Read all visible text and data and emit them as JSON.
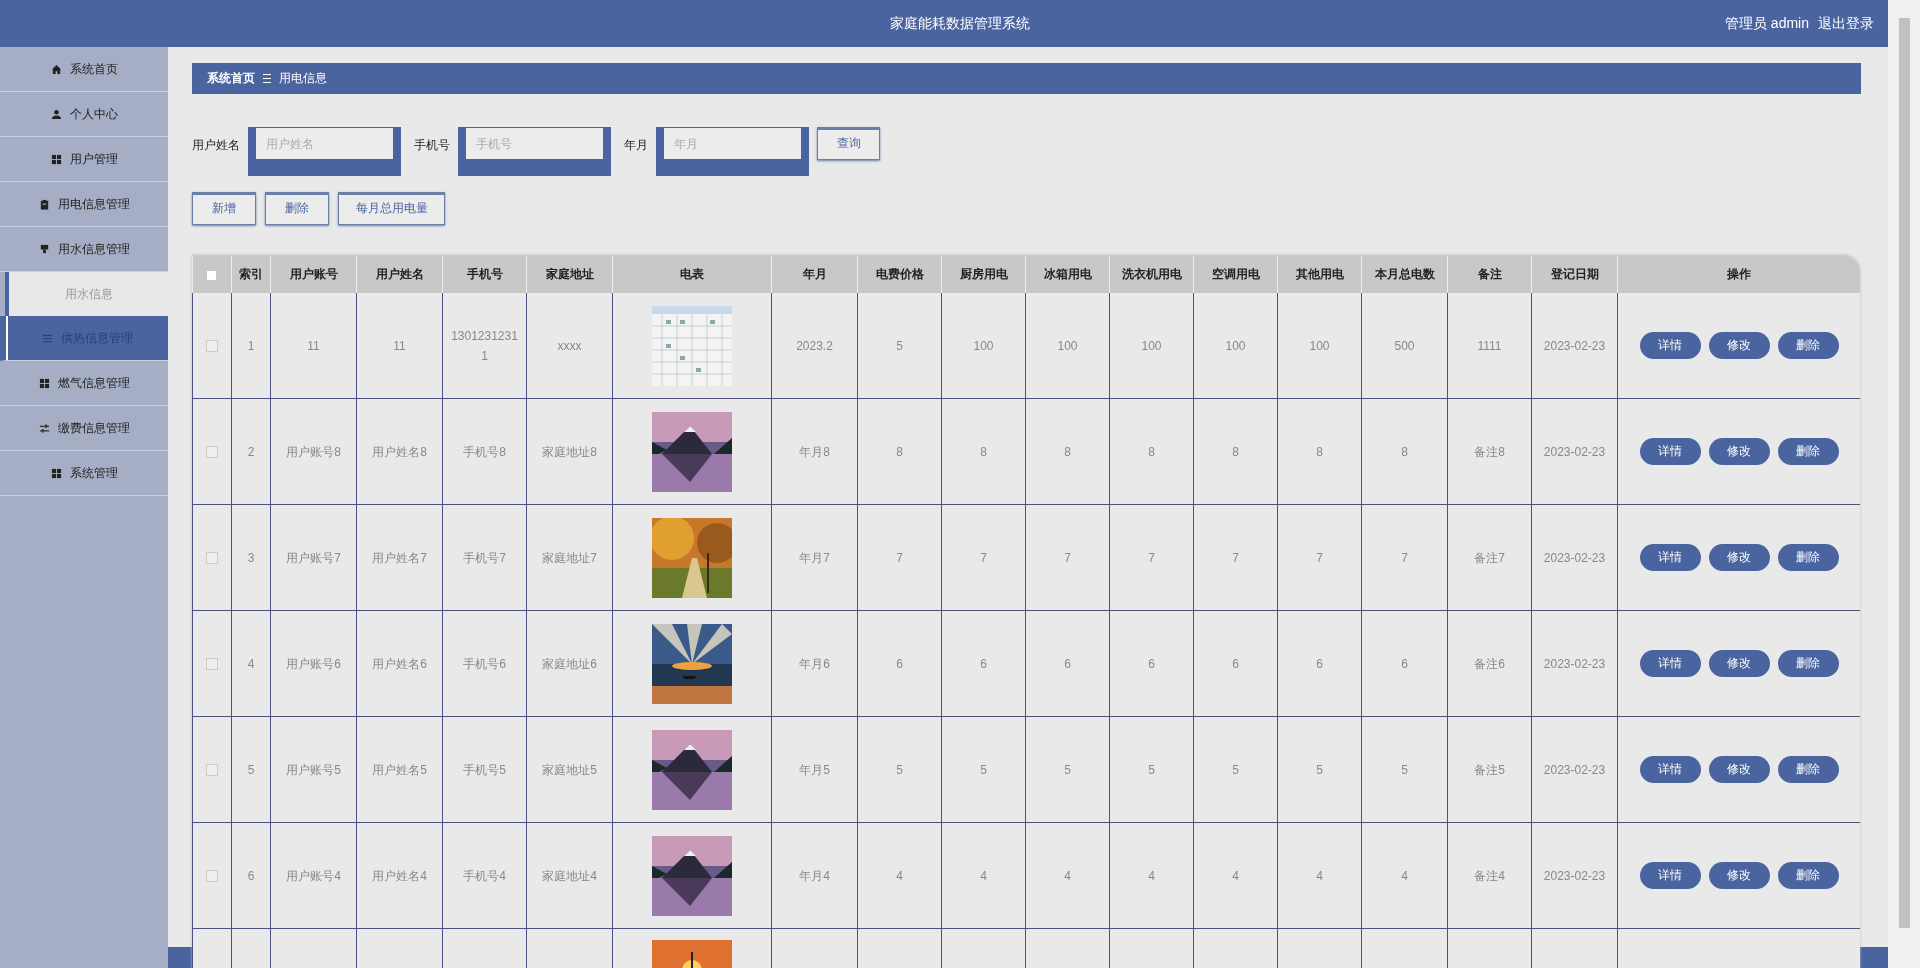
{
  "header": {
    "title": "家庭能耗数据管理系统",
    "user": "管理员 admin",
    "logout": "退出登录"
  },
  "sidebar": {
    "items": [
      {
        "label": "系统首页",
        "selected": false
      },
      {
        "label": "个人中心",
        "selected": false
      },
      {
        "label": "用户管理",
        "selected": false
      },
      {
        "label": "用电信息管理",
        "selected": false
      },
      {
        "label": "用水信息管理",
        "selected": false,
        "expanded": true,
        "children": [
          {
            "label": "用水信息",
            "selected": false
          }
        ]
      },
      {
        "label": "供热信息管理",
        "selected": true
      },
      {
        "label": "燃气信息管理",
        "selected": false
      },
      {
        "label": "缴费信息管理",
        "selected": false
      },
      {
        "label": "系统管理",
        "selected": false
      }
    ]
  },
  "breadcrumb": {
    "home": "系统首页",
    "current": "用电信息"
  },
  "search": {
    "fields": [
      {
        "label": "用户姓名",
        "placeholder": "用户姓名"
      },
      {
        "label": "手机号",
        "placeholder": "手机号"
      },
      {
        "label": "年月",
        "placeholder": "年月"
      }
    ],
    "button": "查询"
  },
  "actions": [
    "新增",
    "删除",
    "每月总用电量"
  ],
  "table": {
    "select_all": {
      "checked": false
    },
    "columns": [
      "索引",
      "用户账号",
      "用户姓名",
      "手机号",
      "家庭地址",
      "电表",
      "年月",
      "电费价格",
      "厨房用电",
      "冰箱用电",
      "洗衣机用电",
      "空调用电",
      "其他用电",
      "本月总电数",
      "备注",
      "登记日期",
      "操作"
    ],
    "rows": [
      {
        "checked": false,
        "cells": [
          "1",
          "11",
          "11",
          "13012312311",
          "xxxx",
          {
            "kind": "picture"
          },
          "2023.2",
          "5",
          "100",
          "100",
          "100",
          "100",
          "100",
          "500",
          "1111",
          "2023-02-23"
        ],
        "buttons": [
          "详情",
          "修改",
          "删除"
        ]
      },
      {
        "checked": false,
        "cells": [
          "2",
          "用户账号8",
          "用户姓名8",
          "手机号8",
          "家庭地址8",
          {
            "kind": "picture"
          },
          "年月8",
          "8",
          "8",
          "8",
          "8",
          "8",
          "8",
          "8",
          "备注8",
          "2023-02-23"
        ],
        "buttons": [
          "详情",
          "修改",
          "删除"
        ]
      },
      {
        "checked": false,
        "cells": [
          "3",
          "用户账号7",
          "用户姓名7",
          "手机号7",
          "家庭地址7",
          {
            "kind": "picture"
          },
          "年月7",
          "7",
          "7",
          "7",
          "7",
          "7",
          "7",
          "7",
          "备注7",
          "2023-02-23"
        ],
        "buttons": [
          "详情",
          "修改",
          "删除"
        ]
      },
      {
        "checked": false,
        "cells": [
          "4",
          "用户账号6",
          "用户姓名6",
          "手机号6",
          "家庭地址6",
          {
            "kind": "picture"
          },
          "年月6",
          "6",
          "6",
          "6",
          "6",
          "6",
          "6",
          "6",
          "备注6",
          "2023-02-23"
        ],
        "buttons": [
          "详情",
          "修改",
          "删除"
        ]
      },
      {
        "checked": false,
        "cells": [
          "5",
          "用户账号5",
          "用户姓名5",
          "手机号5",
          "家庭地址5",
          {
            "kind": "picture"
          },
          "年月5",
          "5",
          "5",
          "5",
          "5",
          "5",
          "5",
          "5",
          "备注5",
          "2023-02-23"
        ],
        "buttons": [
          "详情",
          "修改",
          "删除"
        ]
      },
      {
        "checked": false,
        "cells": [
          "6",
          "用户账号4",
          "用户姓名4",
          "手机号4",
          "家庭地址4",
          {
            "kind": "picture"
          },
          "年月4",
          "4",
          "4",
          "4",
          "4",
          "4",
          "4",
          "4",
          "备注4",
          "2023-02-23"
        ],
        "buttons": [
          "详情",
          "修改",
          "删除"
        ]
      }
    ],
    "partial_row": {
      "image": {
        "kind": "picture"
      }
    }
  }
}
